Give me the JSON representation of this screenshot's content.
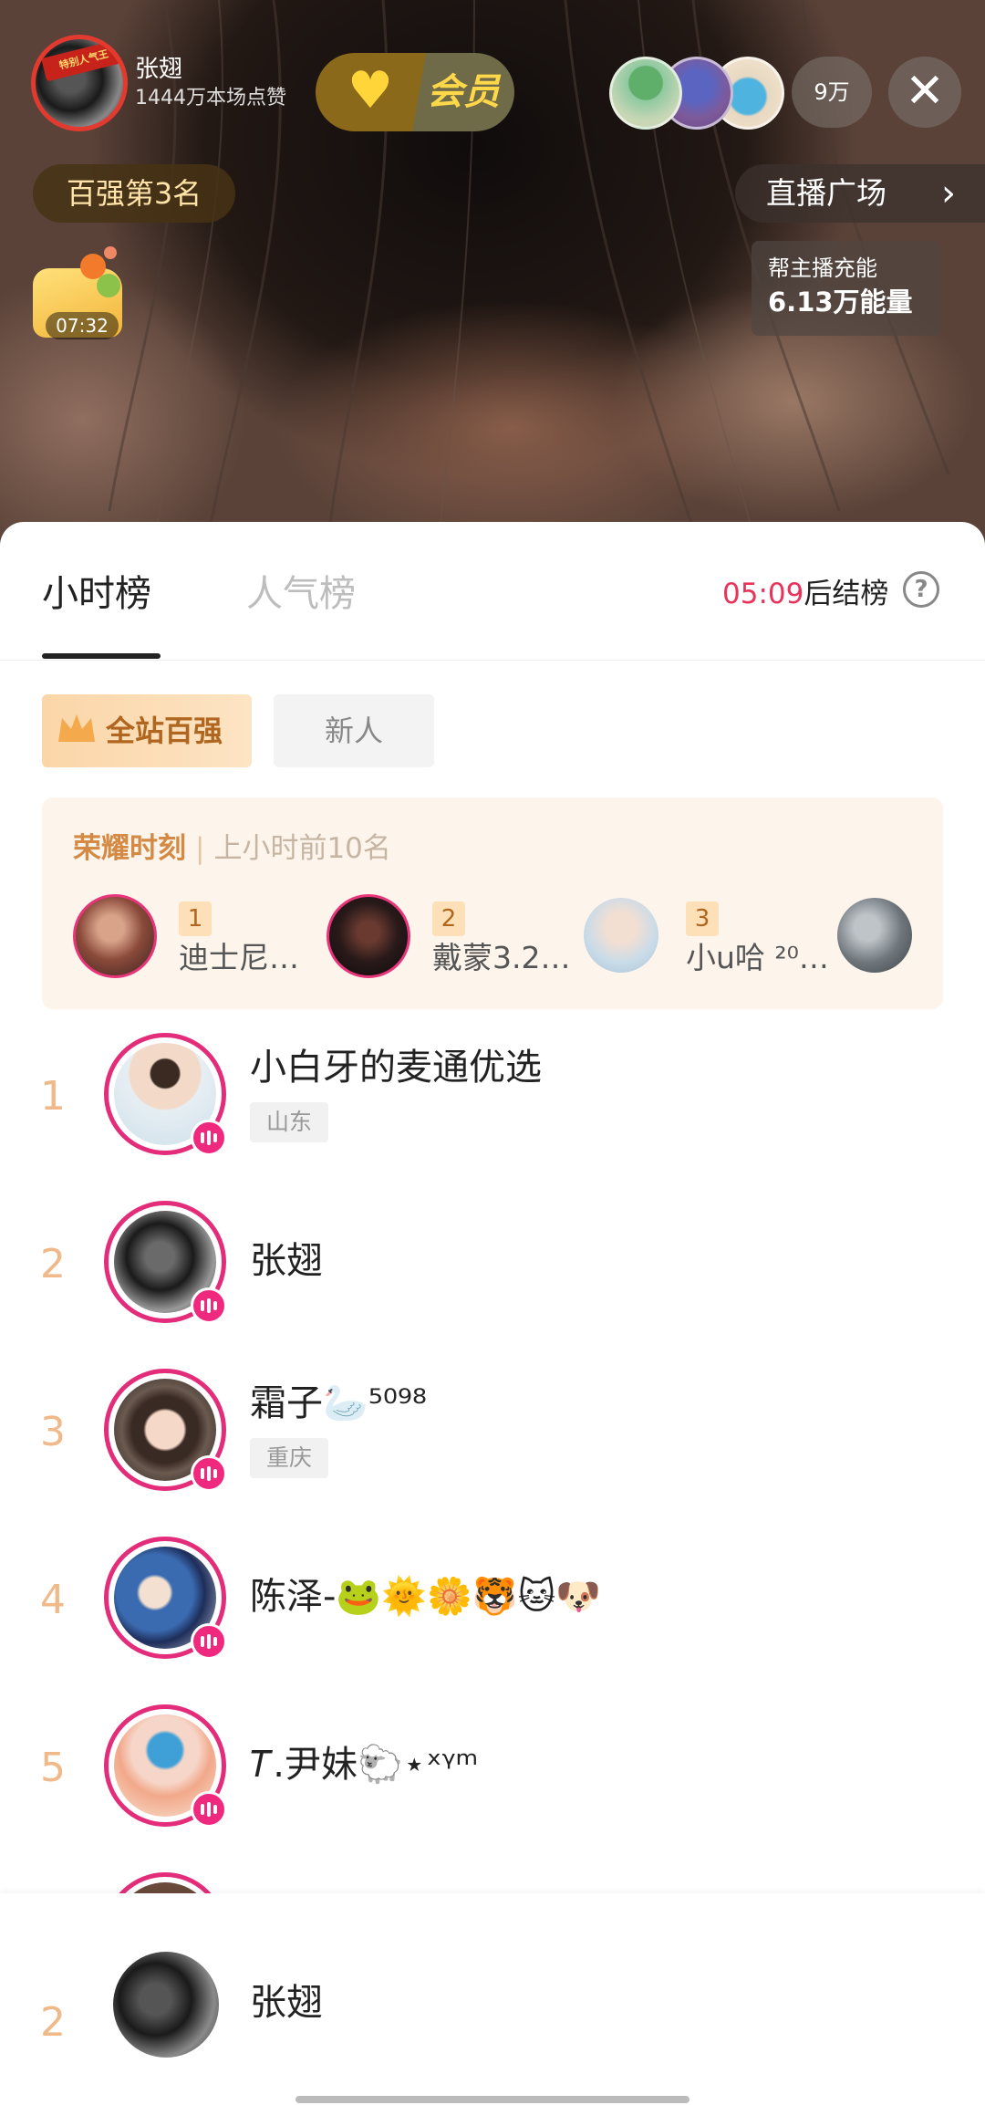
{
  "host": {
    "name": "张翅",
    "likes": "1444万本场点赞",
    "avatar_banner": "特别人气王"
  },
  "vip": {
    "label": "会员"
  },
  "viewers": {
    "count": "9万"
  },
  "rank_pill": "百强第3名",
  "plaza": {
    "label": "直播广场"
  },
  "gift": {
    "timer": "07:32"
  },
  "energy": {
    "title": "帮主播充能",
    "value": "6.13万能量"
  },
  "tabs": [
    {
      "label": "小时榜",
      "active": true
    },
    {
      "label": "人气榜",
      "active": false
    }
  ],
  "countdown": {
    "time": "05:09",
    "suffix": "后结榜"
  },
  "chips": [
    {
      "label": "全站百强",
      "active": true
    },
    {
      "label": "新人",
      "active": false
    }
  ],
  "honor": {
    "title": "荣耀时刻",
    "subtitle": "上小时前10名",
    "items": [
      {
        "rank": "1",
        "name": "迪士尼…"
      },
      {
        "rank": "2",
        "name": "戴蒙3.2…"
      },
      {
        "rank": "3",
        "name": "小u哈 ²⁰…"
      }
    ]
  },
  "ranking": [
    {
      "rank": "1",
      "name": "小白牙的麦通优选",
      "region": "山东"
    },
    {
      "rank": "2",
      "name": "张翅",
      "region": ""
    },
    {
      "rank": "3",
      "name": "霜子🦢⁵⁰⁹⁸",
      "region": "重庆"
    },
    {
      "rank": "4",
      "name": "陈泽-🐸🌞🌼🐯🐱🐶",
      "region": ""
    },
    {
      "rank": "5",
      "name": "𝑇.尹妹🐑⋆ˣᵞᵐ",
      "region": ""
    }
  ],
  "my_rank": {
    "rank": "2",
    "name": "张翅"
  },
  "colors": {
    "accent_pink": "#e8335b",
    "live_ring": "#e42d7a",
    "rank_number": "#f0b98a",
    "gold": "#ffd84a"
  },
  "icons": [
    "close-icon",
    "chevron-right-icon",
    "help-icon",
    "crown-icon",
    "heart-plus-icon",
    "live-bars-icon"
  ]
}
